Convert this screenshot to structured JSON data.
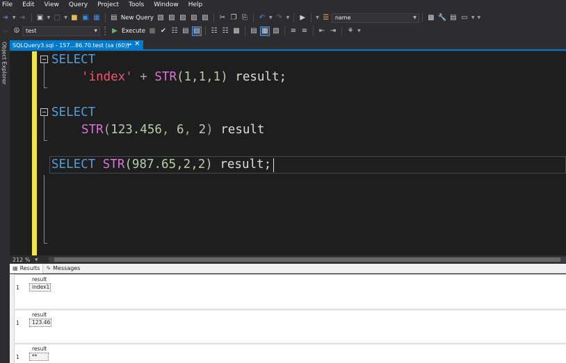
{
  "menu": [
    "File",
    "Edit",
    "View",
    "Query",
    "Project",
    "Tools",
    "Window",
    "Help"
  ],
  "toolbar1": {
    "new_query_label": "New Query",
    "name_combo_value": "name"
  },
  "toolbar2": {
    "database_combo_value": "test",
    "execute_label": "Execute"
  },
  "side_panel": {
    "object_explorer_label": "Object Explorer"
  },
  "document_tab": {
    "title": "SQLQuery3.sql - 157...86.70.test (sa (60))*"
  },
  "editor": {
    "lines": {
      "l1_kw": "SELECT",
      "l2_str": "'index'",
      "l2_op": " + ",
      "l2_fn": "STR",
      "l2_args": "(1,1,1)",
      "l2_tail": " result;",
      "l3_kw": "SELECT",
      "l4_fn": "STR",
      "l4_open": "(",
      "l4_n1": "123.456",
      "l4_c1": ", ",
      "l4_n2": "6",
      "l4_c2": ", ",
      "l4_n3": "2",
      "l4_close": ")",
      "l4_tail": " result",
      "l5_kw": "SELECT",
      "l5_fn": "STR",
      "l5_args": "(987.65,2,2)",
      "l5_tail": " result;"
    }
  },
  "zoom": {
    "value": "212 %"
  },
  "results_tabs": {
    "results_label": "Results",
    "messages_label": "Messages"
  },
  "result_sets": [
    {
      "column": "result",
      "row_number": "1",
      "value": "index1"
    },
    {
      "column": "result",
      "row_number": "1",
      "value": "123.46"
    },
    {
      "column": "result",
      "row_number": "1",
      "value": "**"
    }
  ],
  "colors": {
    "accent": "#007acc",
    "keyword": "#569cd6",
    "function": "#d972d9",
    "string": "#f0566e",
    "number": "#b5cea8",
    "change_bar": "#efe54b"
  }
}
